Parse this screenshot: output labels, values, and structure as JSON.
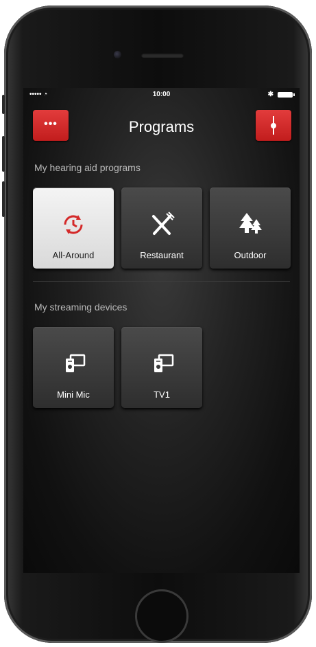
{
  "status_bar": {
    "signal": "••••• ◔",
    "time": "10:00",
    "bluetooth": "✱"
  },
  "header": {
    "title": "Programs",
    "menu_label": "•••"
  },
  "sections": {
    "programs_label": "My hearing aid programs",
    "streaming_label": "My streaming devices"
  },
  "programs": [
    {
      "label": "All-Around",
      "icon": "clock-arrows-icon",
      "selected": true
    },
    {
      "label": "Restaurant",
      "icon": "fork-knife-icon",
      "selected": false
    },
    {
      "label": "Outdoor",
      "icon": "trees-icon",
      "selected": false
    }
  ],
  "devices": [
    {
      "label": "Mini Mic",
      "icon": "streaming-device-icon"
    },
    {
      "label": "TV1",
      "icon": "streaming-device-icon"
    }
  ],
  "colors": {
    "accent": "#d42a2a",
    "background": "#1a1a1a",
    "tile": "#3a3a3a",
    "tile_active": "#ececec"
  }
}
